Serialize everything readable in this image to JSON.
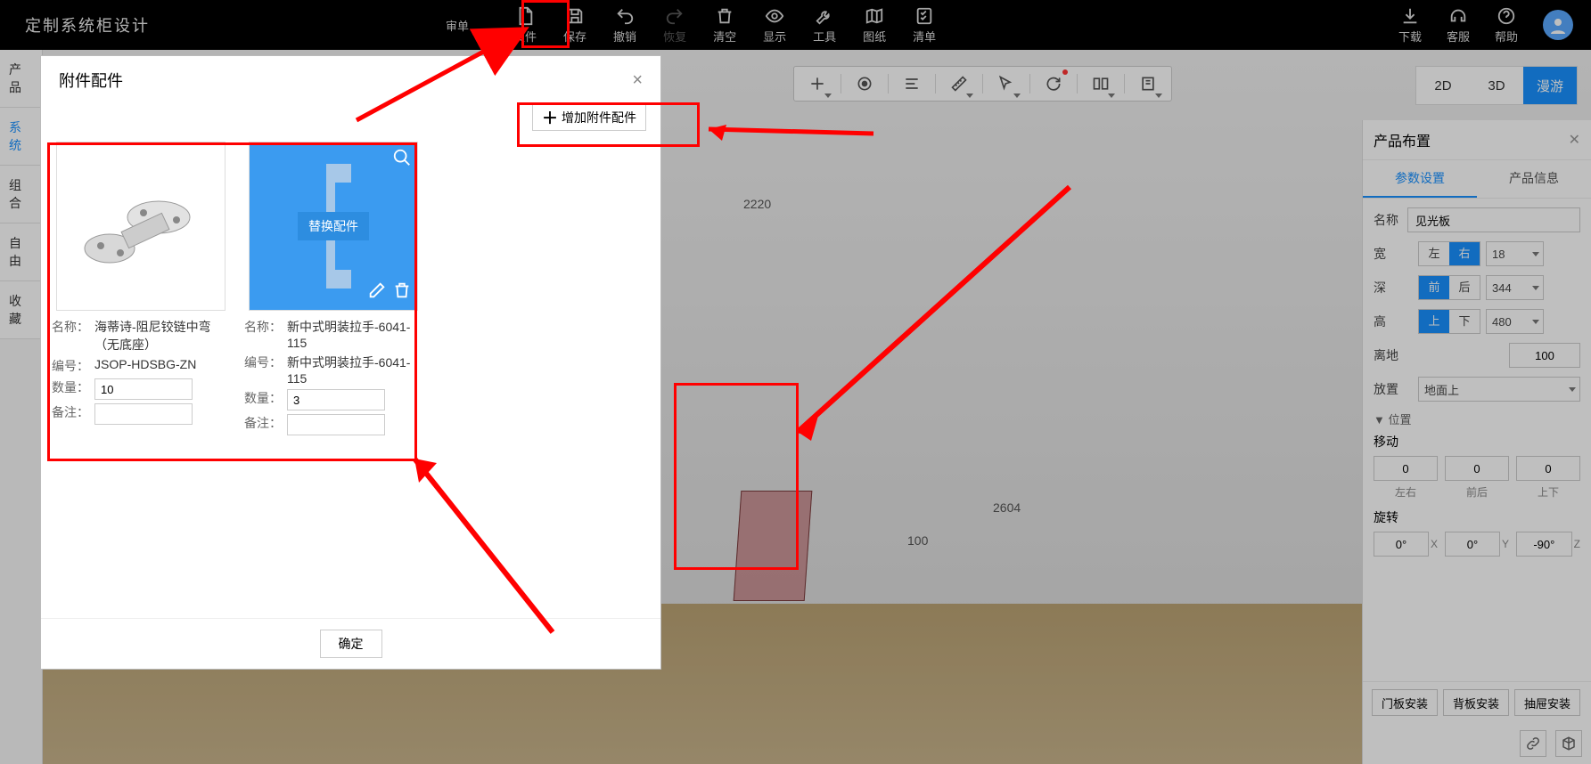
{
  "app_title": "定制系统柜设计",
  "topbar": {
    "center": [
      {
        "label": "审单",
        "icon": "audit",
        "audit": true
      },
      {
        "label": "文件",
        "icon": "file"
      },
      {
        "label": "保存",
        "icon": "save"
      },
      {
        "label": "撤销",
        "icon": "undo"
      },
      {
        "label": "恢复",
        "icon": "redo",
        "disabled": true
      },
      {
        "label": "清空",
        "icon": "trash"
      },
      {
        "label": "显示",
        "icon": "eye"
      },
      {
        "label": "工具",
        "icon": "wrench"
      },
      {
        "label": "图纸",
        "icon": "map"
      },
      {
        "label": "清单",
        "icon": "check"
      }
    ],
    "right": [
      {
        "label": "下载",
        "icon": "download"
      },
      {
        "label": "客服",
        "icon": "support"
      },
      {
        "label": "帮助",
        "icon": "help"
      }
    ]
  },
  "sidebar": {
    "items": [
      {
        "label": "产品"
      },
      {
        "label": "系统",
        "active": true
      },
      {
        "label": "组合"
      },
      {
        "label": "自由"
      },
      {
        "label": "收藏"
      }
    ]
  },
  "float_tools": [
    "plus",
    "target",
    "list",
    "ruler",
    "cursor",
    "rotate",
    "book",
    "flag"
  ],
  "viewmodes": {
    "a": "2D",
    "b": "3D",
    "c": "漫游"
  },
  "dims": {
    "w1": "2220",
    "w2": "2604",
    "h": "100"
  },
  "rpanel": {
    "title": "产品布置",
    "tabs": {
      "a": "参数设置",
      "b": "产品信息"
    },
    "name_label": "名称",
    "name_val": "见光板",
    "width_label": "宽",
    "width_opts": {
      "l": "左",
      "r": "右"
    },
    "width_val": "18",
    "depth_label": "深",
    "depth_opts": {
      "f": "前",
      "b": "后"
    },
    "depth_val": "344",
    "height_label": "高",
    "height_opts": {
      "u": "上",
      "d": "下"
    },
    "height_val": "480",
    "ground_label": "离地",
    "ground_val": "100",
    "place_label": "放置",
    "place_val": "地面上",
    "pos_section": "▼ 位置",
    "move_label": "移动",
    "move_x": "0",
    "move_y": "0",
    "move_z": "0",
    "move_labels": {
      "lr": "左右",
      "fb": "前后",
      "ud": "上下"
    },
    "rotate_label": "旋转",
    "rot_x": "0°",
    "rot_y": "0°",
    "rot_z": "-90°",
    "rot_labels": {
      "x": "X",
      "y": "Y",
      "z": "Z"
    },
    "foot": {
      "a": "门板安装",
      "b": "背板安装",
      "c": "抽屉安装"
    }
  },
  "modal": {
    "title": "附件配件",
    "add_btn": "增加附件配件",
    "ok": "确定",
    "replace": "替换配件",
    "labels": {
      "name": "名称：",
      "code": "编号：",
      "qty": "数量：",
      "note": "备注："
    },
    "items": [
      {
        "name": "海蒂诗-阻尼铰链中弯（无底座）",
        "code": "JSOP-HDSBG-ZN",
        "qty": "10",
        "note": ""
      },
      {
        "name": "新中式明装拉手-6041-115",
        "code": "新中式明装拉手-6041-115",
        "qty": "3",
        "note": ""
      }
    ]
  }
}
